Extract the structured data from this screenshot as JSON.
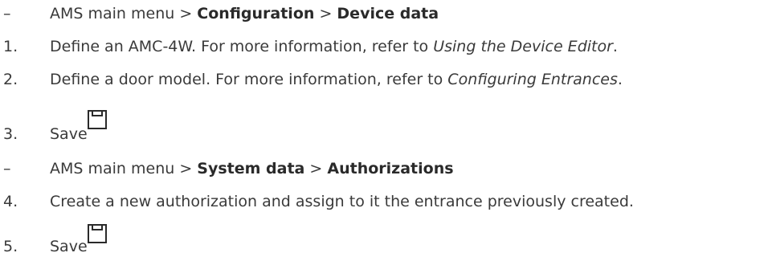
{
  "steps": [
    {
      "marker": "–",
      "parts": [
        "AMS main menu > ",
        "Configuration",
        " > ",
        "Device data"
      ]
    },
    {
      "marker": "1.",
      "parts": [
        "Define an AMC-4W. For more information, refer to ",
        "Using the Device Editor",
        "."
      ]
    },
    {
      "marker": "2.",
      "parts": [
        "Define a door model. For more information, refer to ",
        "Configuring Entrances",
        "."
      ]
    },
    {
      "marker": "3.",
      "label": "Save",
      "icon": "save-icon"
    },
    {
      "marker": "–",
      "parts": [
        "AMS main menu > ",
        "System data",
        " > ",
        "Authorizations"
      ]
    },
    {
      "marker": "4.",
      "parts": [
        "Create a new authorization and assign to it the entrance previously created."
      ]
    },
    {
      "marker": "5.",
      "label": "Save",
      "icon": "save-icon"
    }
  ]
}
